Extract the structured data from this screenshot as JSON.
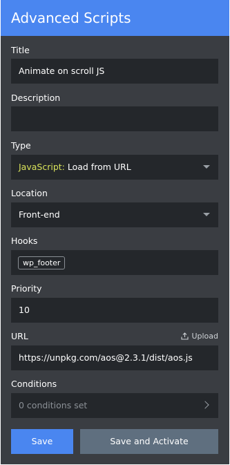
{
  "header": {
    "title": "Advanced Scripts"
  },
  "fields": {
    "title": {
      "label": "Title",
      "value": "Animate on scroll JS"
    },
    "description": {
      "label": "Description",
      "value": ""
    },
    "type": {
      "label": "Type",
      "lang": "JavaScript:",
      "rest": " Load from URL"
    },
    "location": {
      "label": "Location",
      "value": "Front-end"
    },
    "hooks": {
      "label": "Hooks",
      "chips": [
        "wp_footer"
      ]
    },
    "priority": {
      "label": "Priority",
      "value": "10"
    },
    "url": {
      "label": "URL",
      "upload_label": "Upload",
      "value": "https://unpkg.com/aos@2.3.1/dist/aos.js"
    },
    "conditions": {
      "label": "Conditions",
      "value": "0 conditions set"
    }
  },
  "buttons": {
    "save": "Save",
    "save_activate": "Save and Activate"
  },
  "colors": {
    "accent": "#4a86f0",
    "panel": "#3a3d42",
    "field": "#24272b",
    "lang": "#d9e35a"
  }
}
